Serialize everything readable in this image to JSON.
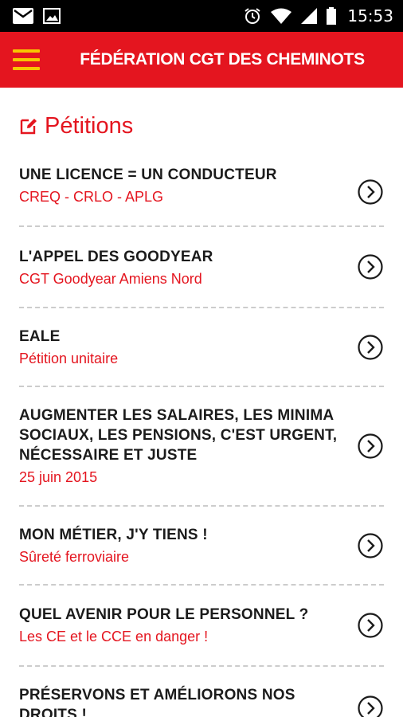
{
  "status_bar": {
    "time": "15:53",
    "icons": [
      "mail-icon",
      "image-icon",
      "alarm-icon",
      "wifi-icon",
      "signal-icon",
      "battery-icon"
    ]
  },
  "app_bar": {
    "title": "FÉDÉRATION CGT DES CHEMINOTS",
    "accent_color": "#e4151f",
    "menu_color": "#f7c600"
  },
  "section": {
    "title": "Pétitions",
    "icon": "edit-icon"
  },
  "petitions": [
    {
      "title": "UNE LICENCE = UN CONDUCTEUR",
      "subtitle": "CREQ - CRLO - APLG"
    },
    {
      "title": "L'APPEL DES GOODYEAR",
      "subtitle": "CGT Goodyear Amiens Nord"
    },
    {
      "title": "EALE",
      "subtitle": "Pétition unitaire"
    },
    {
      "title": "AUGMENTER LES SALAIRES, LES MINIMA SOCIAUX, LES PENSIONS, C'EST URGENT, NÉCESSAIRE ET JUSTE",
      "subtitle": "25 juin 2015"
    },
    {
      "title": "MON MÉTIER, J'Y TIENS !",
      "subtitle": "Sûreté ferroviaire"
    },
    {
      "title": "QUEL AVENIR POUR LE PERSONNEL ?",
      "subtitle": "Les CE et le CCE en danger !"
    },
    {
      "title": "PRÉSERVONS ET AMÉLIORONS NOS DROITS !",
      "subtitle": ""
    }
  ]
}
